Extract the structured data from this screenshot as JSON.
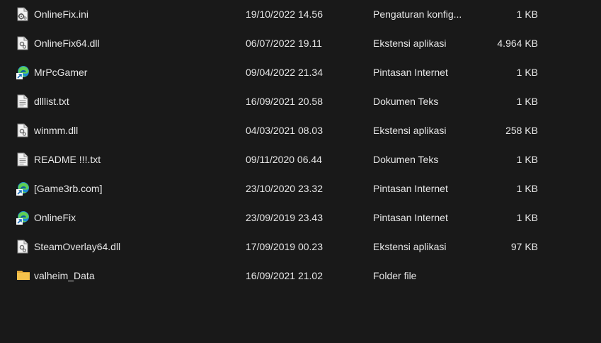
{
  "colors": {
    "background": "#191919",
    "text": "#e6e6e6",
    "folder": "#f5c24c",
    "edge_blue": "#1e8bd8",
    "edge_green": "#5fcf54"
  },
  "files": [
    {
      "name": "OnlineFix.ini",
      "date": "19/10/2022 14.56",
      "type": "Pengaturan konfig...",
      "size": "1 KB",
      "icon": "config-settings-icon"
    },
    {
      "name": "OnlineFix64.dll",
      "date": "06/07/2022 19.11",
      "type": "Ekstensi aplikasi",
      "size": "4.964 KB",
      "icon": "dll-file-icon"
    },
    {
      "name": "MrPcGamer",
      "date": "09/04/2022 21.34",
      "type": "Pintasan Internet",
      "size": "1 KB",
      "icon": "edge-shortcut-icon"
    },
    {
      "name": "dlllist.txt",
      "date": "16/09/2021 20.58",
      "type": "Dokumen Teks",
      "size": "1 KB",
      "icon": "text-file-icon"
    },
    {
      "name": "winmm.dll",
      "date": "04/03/2021 08.03",
      "type": "Ekstensi aplikasi",
      "size": "258 KB",
      "icon": "dll-file-icon"
    },
    {
      "name": "README !!!.txt",
      "date": "09/11/2020 06.44",
      "type": "Dokumen Teks",
      "size": "1 KB",
      "icon": "text-file-icon"
    },
    {
      "name": "[Game3rb.com]",
      "date": "23/10/2020 23.32",
      "type": "Pintasan Internet",
      "size": "1 KB",
      "icon": "edge-shortcut-icon"
    },
    {
      "name": "OnlineFix",
      "date": "23/09/2019 23.43",
      "type": "Pintasan Internet",
      "size": "1 KB",
      "icon": "edge-shortcut-icon"
    },
    {
      "name": "SteamOverlay64.dll",
      "date": "17/09/2019 00.23",
      "type": "Ekstensi aplikasi",
      "size": "97 KB",
      "icon": "dll-file-icon"
    },
    {
      "name": "valheim_Data",
      "date": "16/09/2021 21.02",
      "type": "Folder file",
      "size": "",
      "icon": "folder-icon"
    }
  ]
}
